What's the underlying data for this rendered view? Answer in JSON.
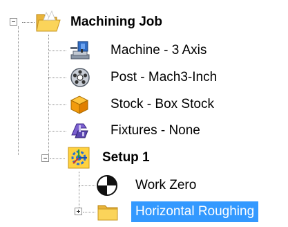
{
  "tree": {
    "root": {
      "label": "Machining Job",
      "icon": "open-folder-icon",
      "expanded": true
    },
    "items": [
      {
        "label": "Machine - 3 Axis",
        "icon": "cnc-machine-icon"
      },
      {
        "label": "Post - Mach3-Inch",
        "icon": "post-processor-reel-icon"
      },
      {
        "label": "Stock - Box Stock",
        "icon": "stock-box-icon"
      },
      {
        "label": "Fixtures - None",
        "icon": "fixtures-clamp-icon"
      }
    ],
    "setup": {
      "label": "Setup 1",
      "icon": "setup-gear-icon",
      "expanded": true,
      "children": [
        {
          "label": "Work Zero",
          "icon": "work-zero-target-icon"
        },
        {
          "label": "Horizontal Roughing",
          "icon": "closed-folder-icon",
          "selected": true,
          "expanded": false
        }
      ]
    }
  },
  "colors": {
    "selection": "#3399ff",
    "tree_lines": "#8a8a8a",
    "folder": "#f5c542"
  }
}
